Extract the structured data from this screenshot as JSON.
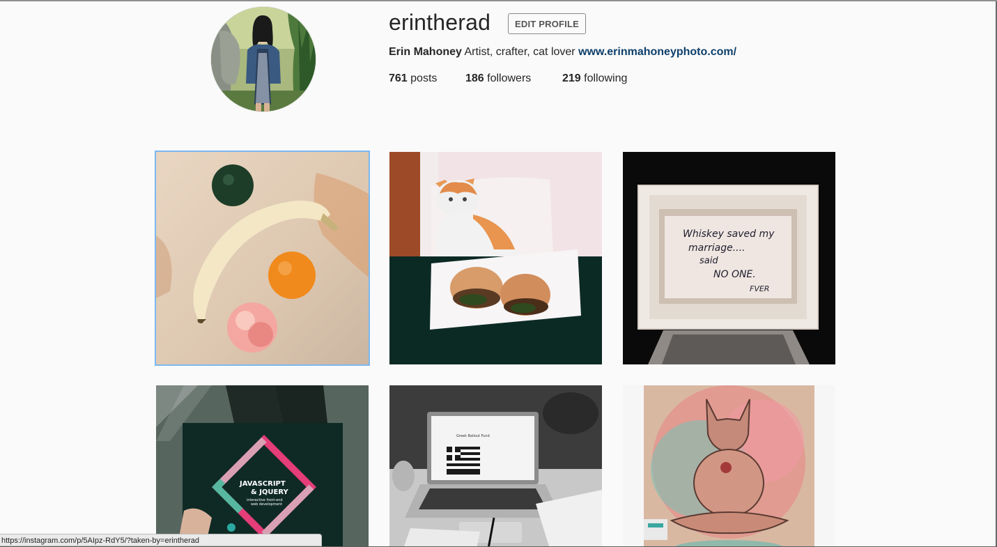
{
  "profile": {
    "username": "erintherad",
    "edit_button": "EDIT PROFILE",
    "full_name": "Erin Mahoney",
    "bio_text": " Artist, crafter, cat lover ",
    "website": "www.erinmahoneyphoto.com/",
    "stats": {
      "posts_count": "761",
      "posts_label": " posts",
      "followers_count": "186",
      "followers_label": " followers",
      "following_count": "219",
      "following_label": " following"
    }
  },
  "posts": [
    {
      "subject": "fruit-on-table"
    },
    {
      "subject": "cat-and-sandwich"
    },
    {
      "subject": "framed-note"
    },
    {
      "subject": "javascript-jquery-book"
    },
    {
      "subject": "laptop-on-desk"
    },
    {
      "subject": "sphynx-cat-painting"
    }
  ],
  "framed_note_text": {
    "line1": "Whiskey saved my",
    "line2": "marriage....",
    "line3": "said",
    "line4": "NO ONE.",
    "line5": "FVER"
  },
  "book": {
    "title_line1": "JAVASCRIPT",
    "title_line2": "& JQUERY",
    "subtitle1": "interactive front-end",
    "subtitle2": "web development"
  },
  "laptop_screen": {
    "heading": "Greek Bailout Fund"
  },
  "status_bar": {
    "url": "https://instagram.com/p/5AIpz-RdY5/?taken-by=erintherad"
  },
  "colors": {
    "link": "#0e3f6a",
    "selection_outline": "#7bb8f0",
    "background": "#fafafa"
  }
}
